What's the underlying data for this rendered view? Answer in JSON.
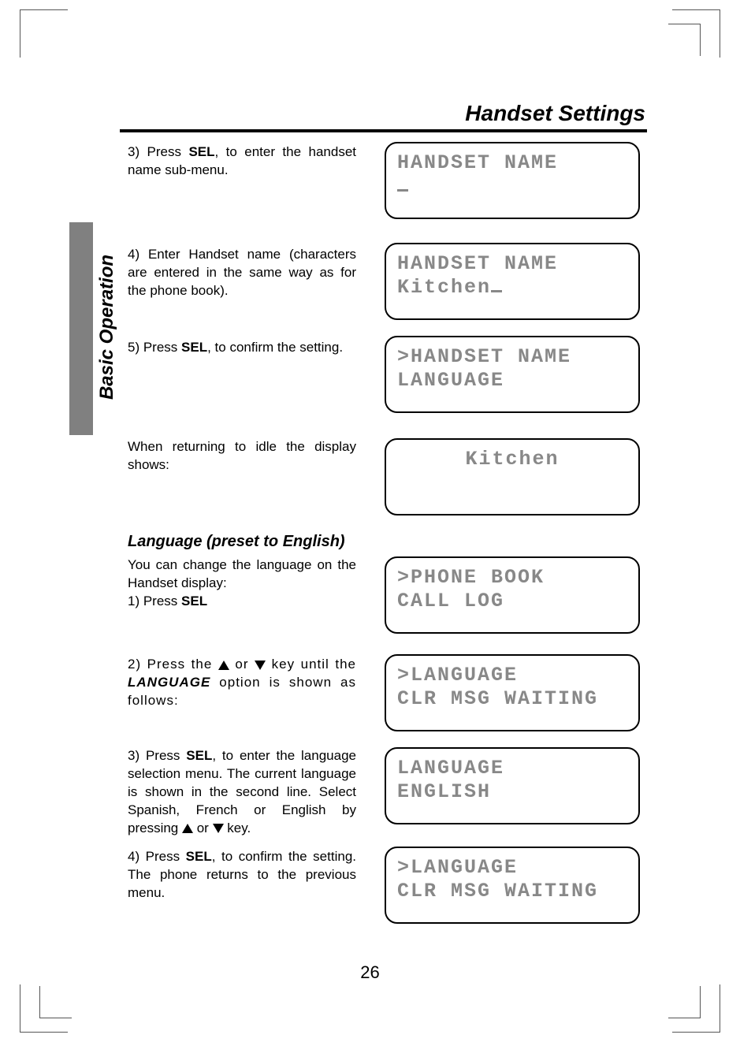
{
  "header": {
    "title": "Handset Settings"
  },
  "side_tab": "Basic Operation",
  "page_number": "26",
  "steps": {
    "s3": "3) Press SEL, to enter the handset name sub-menu.",
    "s4": "4) Enter Handset name (characters are entered in the same way as for the phone book).",
    "s5": "5) Press SEL, to confirm the setting.",
    "idle_note": "When returning to idle the display shows:",
    "lang_head": "Language (preset to English)",
    "lang_intro1": "You can change the language on the Handset display:",
    "lang1": "1) Press SEL",
    "lang2a": "2) Press the ",
    "lang2b": " or ",
    "lang2c": " key until the LANGUAGE option is shown as follows:",
    "lang3": "3) Press SEL, to enter the language selection menu. The current language is shown in the second line. Select Spanish, French or English by pressing ",
    "lang3b": " or ",
    "lang3c": " key.",
    "lang4": "4) Press SEL, to confirm the setting. The phone returns to the previous menu."
  },
  "lcd": {
    "d1_line1": "HANDSET NAME",
    "d2_line1": "HANDSET NAME",
    "d2_line2": "Kitchen",
    "d3_line1": ">HANDSET NAME",
    "d3_line2": " LANGUAGE",
    "d4_line1": "Kitchen",
    "d5_line1": ">PHONE BOOK",
    "d5_line2": " CALL LOG",
    "d6_line1": ">LANGUAGE",
    "d6_line2": " CLR MSG WAITING",
    "d7_line1": "LANGUAGE",
    "d7_line2": "ENGLISH",
    "d8_line1": ">LANGUAGE",
    "d8_line2": " CLR MSG WAITING"
  }
}
